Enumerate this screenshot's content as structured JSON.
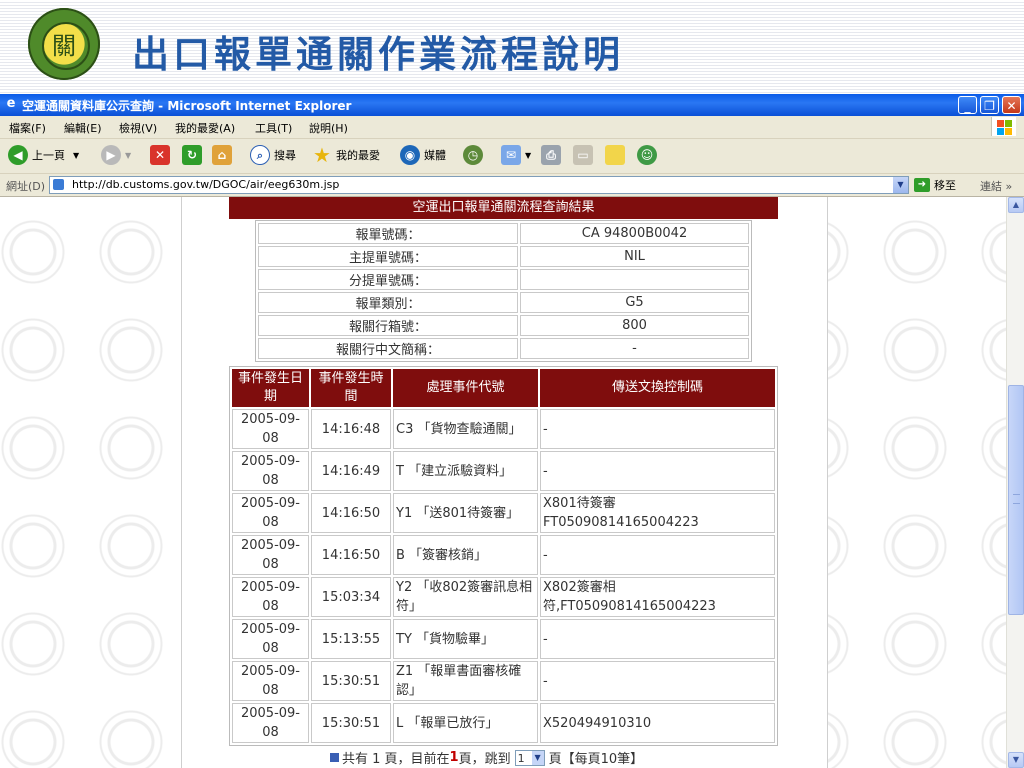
{
  "slide": {
    "title": "出口報單通關作業流程說明",
    "logo_text": "關"
  },
  "window": {
    "title": "空運通關資料庫公示查詢 - Microsoft Internet Explorer",
    "minimize": "_",
    "maximize": "❐",
    "close": "✕"
  },
  "menu": [
    "檔案(F)",
    "編輯(E)",
    "檢視(V)",
    "我的最愛(A)",
    "工具(T)",
    "說明(H)"
  ],
  "toolbar": {
    "back_label": "上一頁",
    "search_label": "搜尋",
    "favorites_label": "我的最愛",
    "media_label": "媒體"
  },
  "address": {
    "label": "網址(D)",
    "url": "http://db.customs.gov.tw/DGOC/air/eeg630m.jsp",
    "go_label": "移至",
    "links_label": "連結"
  },
  "result": {
    "header": "空運出口報單通關流程查詢結果",
    "info": [
      {
        "key": "報單號碼：",
        "value": "CA 94800B0042"
      },
      {
        "key": "主提單號碼：",
        "value": "NIL"
      },
      {
        "key": "分提單號碼：",
        "value": ""
      },
      {
        "key": "報單類別：",
        "value": "G5"
      },
      {
        "key": "報關行箱號：",
        "value": "800"
      },
      {
        "key": "報關行中文簡稱：",
        "value": "-"
      }
    ],
    "columns": [
      "事件發生日期",
      "事件發生時間",
      "處理事件代號",
      "傳送文換控制碼"
    ],
    "events": [
      {
        "date": "2005-09-08",
        "time": "14:16:48",
        "code": "C3 「貨物查驗通關」",
        "control": "-"
      },
      {
        "date": "2005-09-08",
        "time": "14:16:49",
        "code": "T 「建立派驗資料」",
        "control": "-"
      },
      {
        "date": "2005-09-08",
        "time": "14:16:50",
        "code": "Y1 「送801待簽審」",
        "control": "X801待簽審 FT05090814165004223"
      },
      {
        "date": "2005-09-08",
        "time": "14:16:50",
        "code": "B 「簽審核銷」",
        "control": "-"
      },
      {
        "date": "2005-09-08",
        "time": "15:03:34",
        "code": "Y2 「收802簽審訊息相符」",
        "control": "X802簽審相符,FT05090814165004223"
      },
      {
        "date": "2005-09-08",
        "time": "15:13:55",
        "code": "TY 「貨物驗畢」",
        "control": "-"
      },
      {
        "date": "2005-09-08",
        "time": "15:30:51",
        "code": "Z1 「報單書面審核確認」",
        "control": "-"
      },
      {
        "date": "2005-09-08",
        "time": "15:30:51",
        "code": "L 「報單已放行」",
        "control": "X520494910310"
      }
    ],
    "pager": {
      "prefix": "共有 1 頁，目前在",
      "current": "1",
      "middle": "頁，跳到",
      "select_value": "1",
      "suffix": "頁【每頁10筆】"
    }
  },
  "colors": {
    "title_blue": "#235aa6",
    "header_red": "#7f0d0d",
    "xp_blue": "#0a5ce8"
  }
}
